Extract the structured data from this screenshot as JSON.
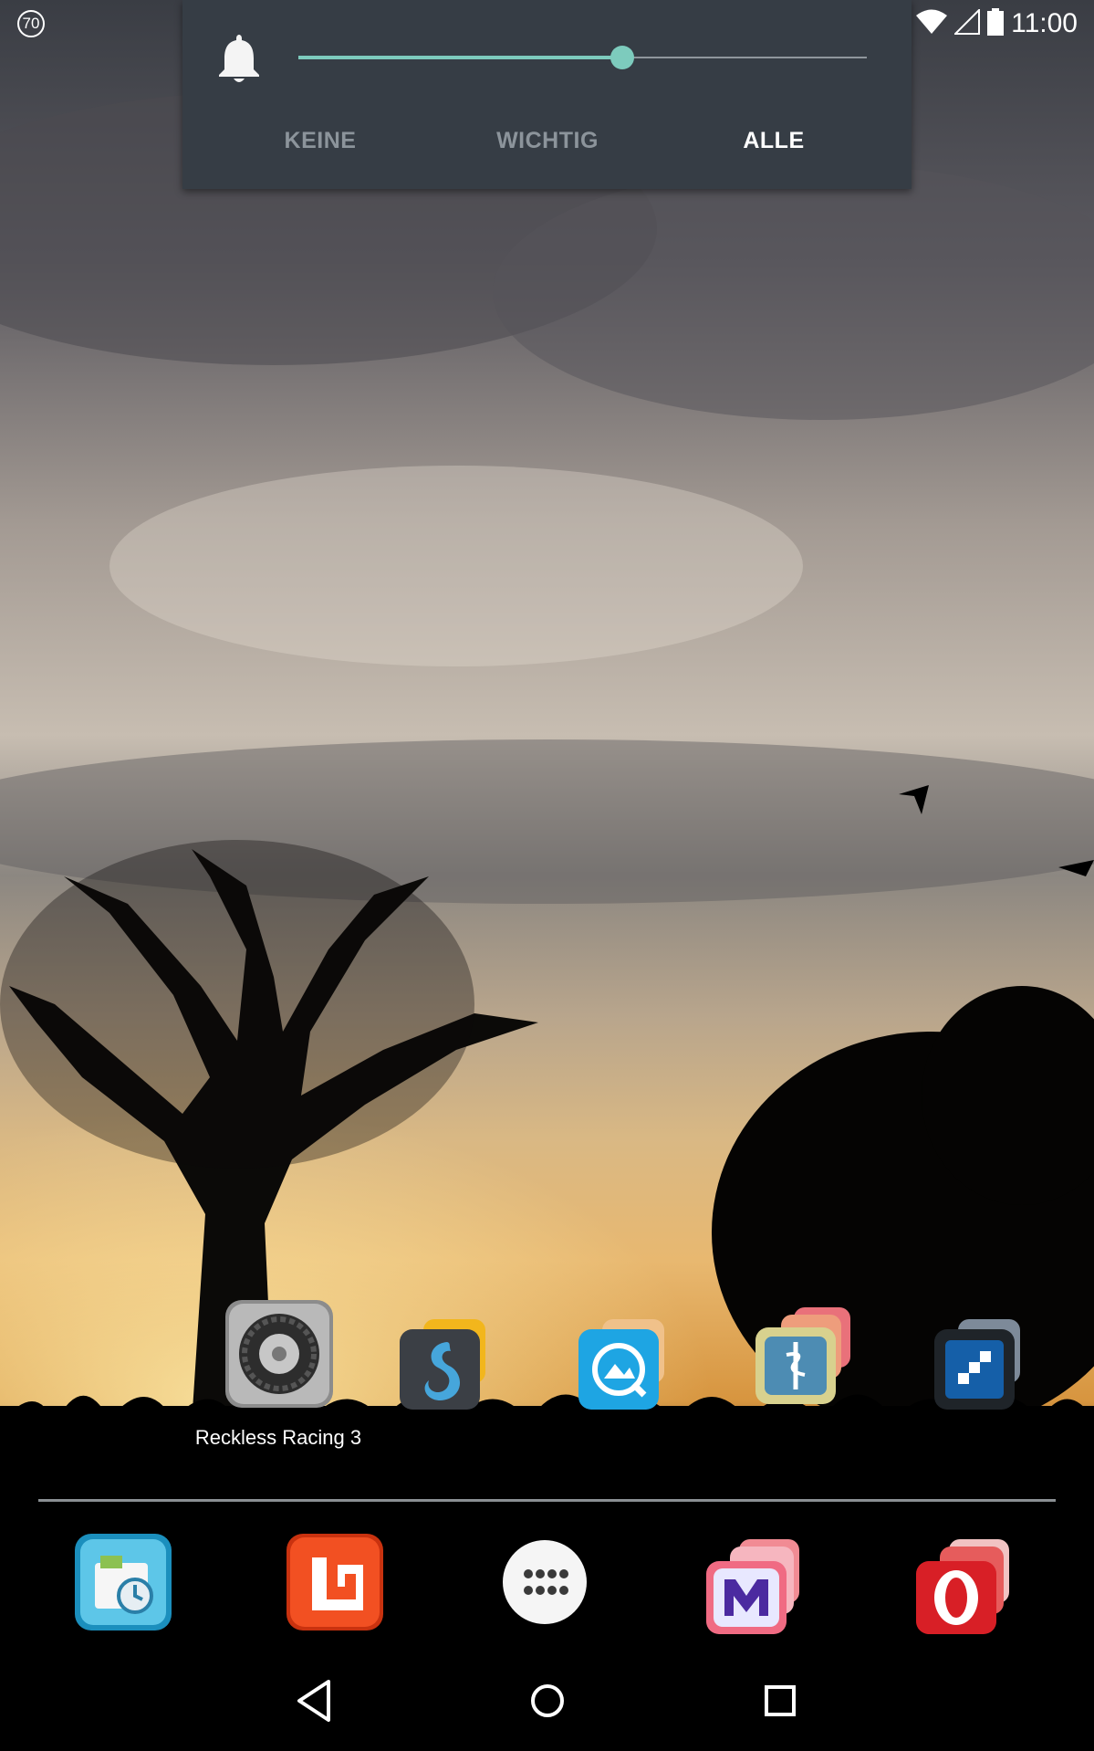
{
  "status_bar": {
    "notification_count": "70",
    "time": "11:00",
    "icons": [
      "wifi-icon",
      "signal-icon",
      "battery-icon"
    ]
  },
  "volume_panel": {
    "icon": "bell-icon",
    "level_percent": 57,
    "modes": [
      {
        "label": "KEINE",
        "active": false
      },
      {
        "label": "WICHTIG",
        "active": false
      },
      {
        "label": "ALLE",
        "active": true
      }
    ],
    "accent_color": "#7dcbbd"
  },
  "home_screen": {
    "visible_label": "Reckless Racing 3",
    "apps": [
      "reckless-racing-3",
      "simplenote-folder",
      "quickpic-folder",
      "medical-folder",
      "blue-app-folder"
    ]
  },
  "dock": {
    "apps": [
      "app-backup-restore",
      "office-suite",
      "app-drawer",
      "messenger-folder",
      "opera-folder"
    ]
  },
  "navigation_bar": {
    "buttons": [
      "back-icon",
      "home-icon",
      "recents-icon"
    ]
  }
}
